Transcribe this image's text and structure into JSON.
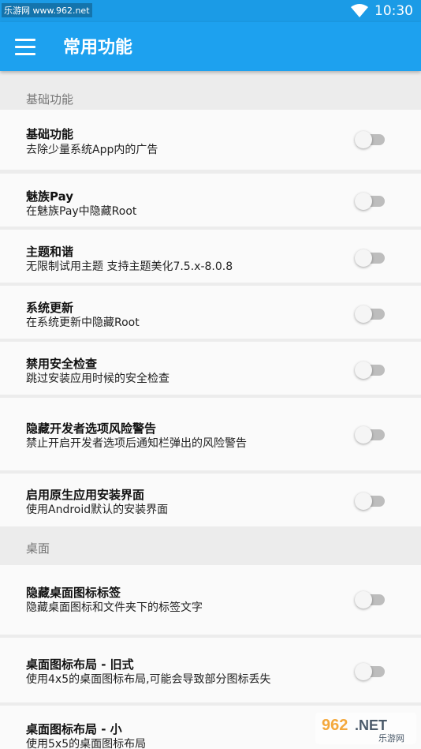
{
  "status_bar": {
    "watermark": "乐游网 www.962.net",
    "time": "10:30",
    "wifi_icon": "wifi-icon"
  },
  "app_bar": {
    "title": "常用功能",
    "menu_icon": "menu-icon"
  },
  "sections": [
    {
      "header": "基础功能"
    },
    {
      "header": "桌面"
    }
  ],
  "items": [
    {
      "title": "基础功能",
      "subtitle": "去除少量系统App内的广告",
      "enabled": false
    },
    {
      "title": "魅族Pay",
      "subtitle": "在魅族Pay中隐藏Root",
      "enabled": false
    },
    {
      "title": "主题和谐",
      "subtitle": "无限制试用主题 支持主题美化7.5.x-8.0.8",
      "enabled": false
    },
    {
      "title": "系统更新",
      "subtitle": "在系统更新中隐藏Root",
      "enabled": false
    },
    {
      "title": "禁用安全检查",
      "subtitle": "跳过安装应用时候的安全检查",
      "enabled": false
    },
    {
      "title": "隐藏开发者选项风险警告",
      "subtitle": "禁止开启开发者选项后通知栏弹出的风险警告",
      "enabled": false
    },
    {
      "title": "启用原生应用安装界面",
      "subtitle": "使用Android默认的安装界面",
      "enabled": false
    },
    {
      "title": "隐藏桌面图标标签",
      "subtitle": "隐藏桌面图标和文件夹下的标签文字",
      "enabled": false
    },
    {
      "title": "桌面图标布局 - 旧式",
      "subtitle": "使用4x5的桌面图标布局,可能会导致部分图标丢失",
      "enabled": false
    },
    {
      "title": "桌面图标布局 - 小",
      "subtitle": "使用5x5的桌面图标布局",
      "enabled": false
    }
  ],
  "logo_watermark": {
    "text": "962.NET",
    "subtext": "乐游网"
  },
  "colors": {
    "status_bar": "#1b9be6",
    "app_bar": "#1da1ef",
    "background": "#ececec",
    "card": "#fafafa"
  }
}
